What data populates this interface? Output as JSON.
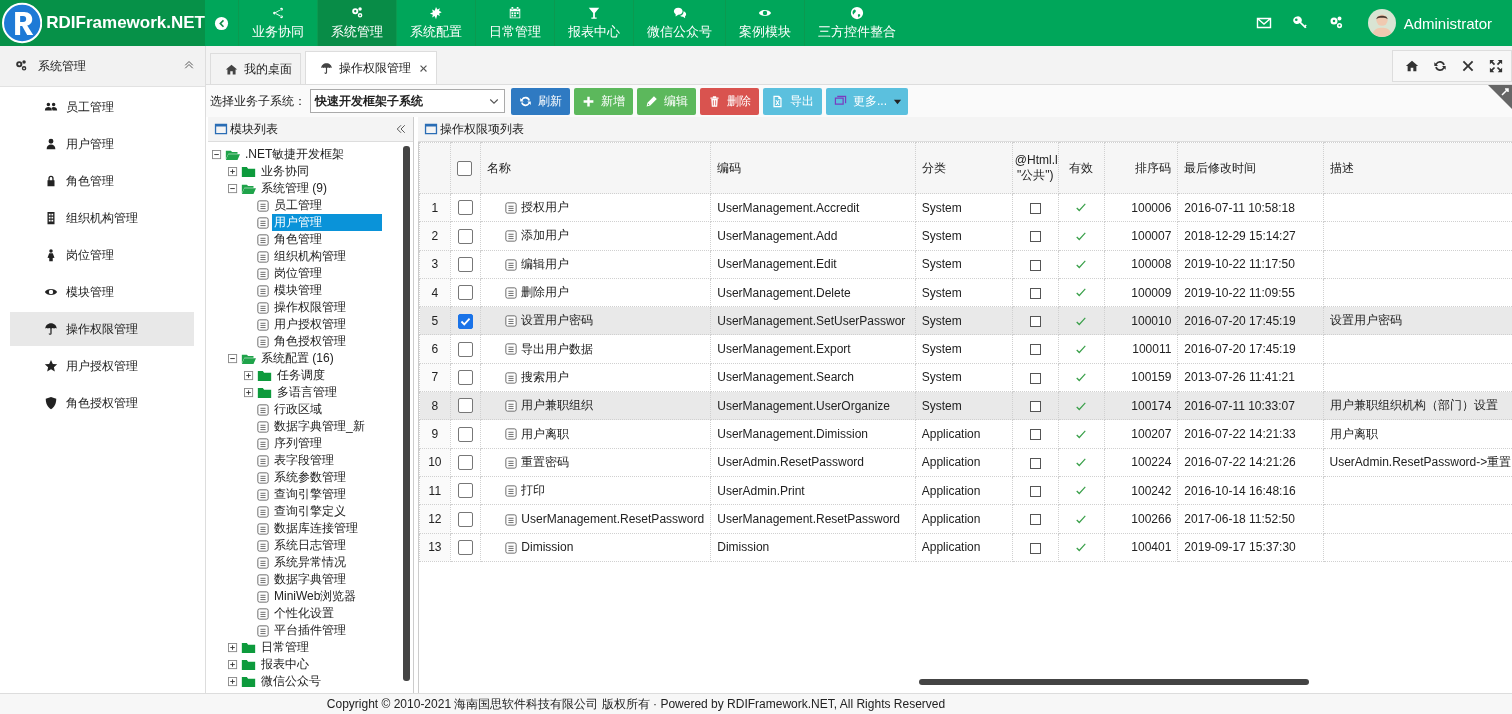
{
  "app": {
    "title": "RDIFramework.NET",
    "user": "Administrator"
  },
  "nav": [
    {
      "label": "业务协同",
      "selected": false
    },
    {
      "label": "系统管理",
      "selected": true
    },
    {
      "label": "系统配置",
      "selected": false
    },
    {
      "label": "日常管理",
      "selected": false
    },
    {
      "label": "报表中心",
      "selected": false
    },
    {
      "label": "微信公众号",
      "selected": false
    },
    {
      "label": "案例模块",
      "selected": false
    },
    {
      "label": "三方控件整合",
      "selected": false
    }
  ],
  "sidebar": {
    "title": "系统管理",
    "expanded": true,
    "items": [
      {
        "label": "员工管理",
        "selected": false
      },
      {
        "label": "用户管理",
        "selected": false
      },
      {
        "label": "角色管理",
        "selected": false
      },
      {
        "label": "组织机构管理",
        "selected": false
      },
      {
        "label": "岗位管理",
        "selected": false
      },
      {
        "label": "模块管理",
        "selected": false
      },
      {
        "label": "操作权限管理",
        "selected": true
      },
      {
        "label": "用户授权管理",
        "selected": false
      },
      {
        "label": "角色授权管理",
        "selected": false
      }
    ]
  },
  "tabs": [
    {
      "label": "我的桌面",
      "selected": false,
      "closable": false
    },
    {
      "label": "操作权限管理",
      "selected": true,
      "closable": true
    }
  ],
  "toolbar": {
    "subsystem_label": "选择业务子系统：",
    "subsystem_value": "快速开发框架子系统",
    "buttons": [
      {
        "label": "刷新",
        "kind": "refresh"
      },
      {
        "label": "新增",
        "kind": "add"
      },
      {
        "label": "编辑",
        "kind": "edit"
      },
      {
        "label": "删除",
        "kind": "delete"
      },
      {
        "label": "导出",
        "kind": "export"
      },
      {
        "label": "更多...",
        "kind": "more"
      }
    ]
  },
  "tree_panel": {
    "title": "模块列表",
    "nodes": [
      {
        "label": ".NET敏捷开发框架",
        "kind": "folder",
        "expanded": true,
        "selected": false,
        "children": [
          {
            "label": "业务协同",
            "kind": "folder",
            "expanded": false,
            "selected": false
          },
          {
            "label": "系统管理 (9)",
            "kind": "folder",
            "expanded": true,
            "selected": false,
            "children": [
              {
                "label": "员工管理",
                "kind": "page",
                "selected": false
              },
              {
                "label": "用户管理",
                "kind": "page",
                "selected": true
              },
              {
                "label": "角色管理",
                "kind": "page",
                "selected": false
              },
              {
                "label": "组织机构管理",
                "kind": "page",
                "selected": false
              },
              {
                "label": "岗位管理",
                "kind": "page",
                "selected": false
              },
              {
                "label": "模块管理",
                "kind": "page",
                "selected": false
              },
              {
                "label": "操作权限管理",
                "kind": "page",
                "selected": false
              },
              {
                "label": "用户授权管理",
                "kind": "page",
                "selected": false
              },
              {
                "label": "角色授权管理",
                "kind": "page",
                "selected": false
              }
            ]
          },
          {
            "label": "系统配置 (16)",
            "kind": "folder",
            "expanded": true,
            "selected": false,
            "children": [
              {
                "label": "任务调度",
                "kind": "folder",
                "expanded": false,
                "selected": false
              },
              {
                "label": "多语言管理",
                "kind": "folder",
                "expanded": false,
                "selected": false
              },
              {
                "label": "行政区域",
                "kind": "page",
                "selected": false
              },
              {
                "label": "数据字典管理_新",
                "kind": "page",
                "selected": false
              },
              {
                "label": "序列管理",
                "kind": "page",
                "selected": false
              },
              {
                "label": "表字段管理",
                "kind": "page",
                "selected": false
              },
              {
                "label": "系统参数管理",
                "kind": "page",
                "selected": false
              },
              {
                "label": "查询引擎管理",
                "kind": "page",
                "selected": false
              },
              {
                "label": "查询引擎定义",
                "kind": "page",
                "selected": false
              },
              {
                "label": "数据库连接管理",
                "kind": "page",
                "selected": false
              },
              {
                "label": "系统日志管理",
                "kind": "page",
                "selected": false
              },
              {
                "label": "系统异常情况",
                "kind": "page",
                "selected": false
              },
              {
                "label": "数据字典管理",
                "kind": "page",
                "selected": false
              },
              {
                "label": "MiniWeb浏览器",
                "kind": "page",
                "selected": false
              },
              {
                "label": "个性化设置",
                "kind": "page",
                "selected": false
              },
              {
                "label": "平台插件管理",
                "kind": "page",
                "selected": false
              }
            ]
          },
          {
            "label": "日常管理",
            "kind": "folder",
            "expanded": false,
            "selected": false
          },
          {
            "label": "报表中心",
            "kind": "folder",
            "expanded": false,
            "selected": false
          },
          {
            "label": "微信公众号",
            "kind": "folder",
            "expanded": false,
            "selected": false
          }
        ]
      }
    ]
  },
  "grid": {
    "title": "操作权限项列表",
    "select_all": false,
    "columns": [
      "名称",
      "编码",
      "分类",
      "@Html.l \"公共\")",
      "有效",
      "排序码",
      "最后修改时间",
      "描述"
    ],
    "rows": [
      {
        "num": "1",
        "checked": false,
        "highlighted": false,
        "name": "授权用户",
        "code": "UserManagement.Accredit",
        "category": "System",
        "public": false,
        "valid": true,
        "sort": "100006",
        "modified": "2016-07-11 10:58:18",
        "description": ""
      },
      {
        "num": "2",
        "checked": false,
        "highlighted": false,
        "name": "添加用户",
        "code": "UserManagement.Add",
        "category": "System",
        "public": false,
        "valid": true,
        "sort": "100007",
        "modified": "2018-12-29 15:14:27",
        "description": ""
      },
      {
        "num": "3",
        "checked": false,
        "highlighted": false,
        "name": "编辑用户",
        "code": "UserManagement.Edit",
        "category": "System",
        "public": false,
        "valid": true,
        "sort": "100008",
        "modified": "2019-10-22 11:17:50",
        "description": ""
      },
      {
        "num": "4",
        "checked": false,
        "highlighted": false,
        "name": "删除用户",
        "code": "UserManagement.Delete",
        "category": "System",
        "public": false,
        "valid": true,
        "sort": "100009",
        "modified": "2019-10-22 11:09:55",
        "description": ""
      },
      {
        "num": "5",
        "checked": true,
        "highlighted": true,
        "name": "设置用户密码",
        "code": "UserManagement.SetUserPasswor",
        "category": "System",
        "public": false,
        "valid": true,
        "sort": "100010",
        "modified": "2016-07-20 17:45:19",
        "description": "设置用户密码"
      },
      {
        "num": "6",
        "checked": false,
        "highlighted": false,
        "name": "导出用户数据",
        "code": "UserManagement.Export",
        "category": "System",
        "public": false,
        "valid": true,
        "sort": "100011",
        "modified": "2016-07-20 17:45:19",
        "description": ""
      },
      {
        "num": "7",
        "checked": false,
        "highlighted": false,
        "name": "搜索用户",
        "code": "UserManagement.Search",
        "category": "System",
        "public": false,
        "valid": true,
        "sort": "100159",
        "modified": "2013-07-26 11:41:21",
        "description": ""
      },
      {
        "num": "8",
        "checked": false,
        "highlighted": true,
        "name": "用户兼职组织",
        "code": "UserManagement.UserOrganize",
        "category": "System",
        "public": false,
        "valid": true,
        "sort": "100174",
        "modified": "2016-07-11 10:33:07",
        "description": "用户兼职组织机构（部门）设置"
      },
      {
        "num": "9",
        "checked": false,
        "highlighted": false,
        "name": "用户离职",
        "code": "UserManagement.Dimission",
        "category": "Application",
        "public": false,
        "valid": true,
        "sort": "100207",
        "modified": "2016-07-22 14:21:33",
        "description": "用户离职"
      },
      {
        "num": "10",
        "checked": false,
        "highlighted": false,
        "name": "重置密码",
        "code": "UserAdmin.ResetPassword",
        "category": "Application",
        "public": false,
        "valid": true,
        "sort": "100224",
        "modified": "2016-07-22 14:21:26",
        "description": "UserAdmin.ResetPassword->重置"
      },
      {
        "num": "11",
        "checked": false,
        "highlighted": false,
        "name": "打印",
        "code": "UserAdmin.Print",
        "category": "Application",
        "public": false,
        "valid": true,
        "sort": "100242",
        "modified": "2016-10-14 16:48:16",
        "description": ""
      },
      {
        "num": "12",
        "checked": false,
        "highlighted": false,
        "name": "UserManagement.ResetPassword",
        "code": "UserManagement.ResetPassword",
        "category": "Application",
        "public": false,
        "valid": true,
        "sort": "100266",
        "modified": "2017-06-18 11:52:50",
        "description": ""
      },
      {
        "num": "13",
        "checked": false,
        "highlighted": false,
        "name": "Dimission",
        "code": "Dimission",
        "category": "Application",
        "public": false,
        "valid": true,
        "sort": "100401",
        "modified": "2019-09-17 15:37:30",
        "description": ""
      }
    ]
  },
  "footer": "Copyright © 2010-2021 海南国思软件科技有限公司 版权所有 · Powered by RDIFramework.NET, All Rights Reserved"
}
